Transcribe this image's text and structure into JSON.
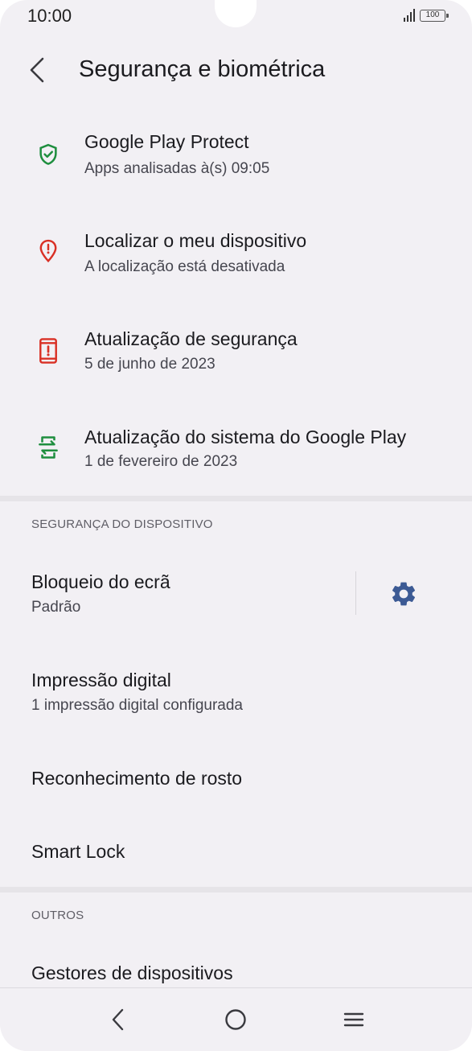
{
  "status_bar": {
    "time": "10:00",
    "battery_level": "100",
    "icons": [
      "signal-icon",
      "battery-icon"
    ]
  },
  "header": {
    "title": "Segurança e biométrica",
    "back_icon": "arrow-back-icon"
  },
  "security_items": [
    {
      "title": "Google Play Protect",
      "subtitle": "Apps analisadas à(s) 09:05",
      "icon": "shield-check-icon",
      "color": "#1e8e3e"
    },
    {
      "title": "Localizar o meu dispositivo",
      "subtitle": "A localização está desativada",
      "icon": "location-alert-icon",
      "color": "#d93025"
    },
    {
      "title": "Atualização de segurança",
      "subtitle": "5 de junho de 2023",
      "icon": "phone-alert-icon",
      "color": "#d93025"
    },
    {
      "title": "Atualização do sistema do Google Play",
      "subtitle": "1 de fevereiro de 2023",
      "icon": "phone-update-icon",
      "color": "#1e8e3e"
    }
  ],
  "device_security": {
    "header": "SEGURANÇA DO DISPOSITIVO",
    "screen_lock": {
      "title": "Bloqueio do ecrã",
      "subtitle": "Padrão",
      "settings_icon": "gear-icon",
      "accent": "#3c5a94"
    },
    "fingerprint": {
      "title": "Impressão digital",
      "subtitle": "1 impressão digital configurada"
    },
    "face_recognition": {
      "title": "Reconhecimento de rosto"
    },
    "smart_lock": {
      "title": "Smart Lock"
    }
  },
  "others": {
    "header": "OUTROS",
    "device_admins": {
      "title": "Gestores de dispositivos"
    }
  },
  "nav_bar": {
    "icons": [
      "nav-back-icon",
      "nav-home-icon",
      "nav-menu-icon"
    ]
  }
}
